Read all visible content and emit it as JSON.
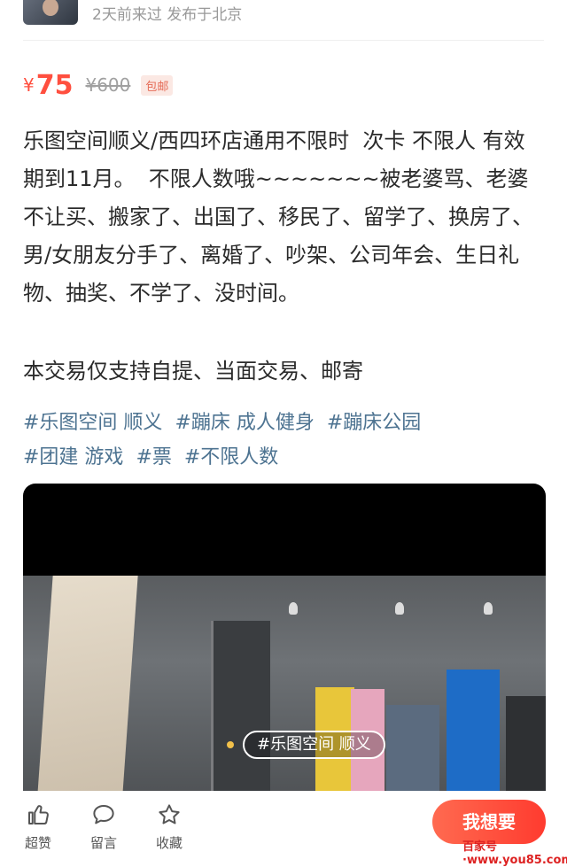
{
  "seller": {
    "meta": "2天前来过  发布于北京"
  },
  "price": {
    "currency": "¥",
    "current": "75",
    "original": "¥600",
    "shipping_tag": "包邮"
  },
  "description": "乐图空间顺义/西四环店通用不限时  次卡 不限人 有效期到11月。  不限人数哦~~~~~~~被老婆骂、老婆不让买、搬家了、出国了、移民了、留学了、换房了、男/女朋友分手了、离婚了、吵架、公司年会、生日礼物、抽奖、不学了、没时间。",
  "trade_note": "本交易仅支持自提、当面交易、邮寄",
  "tags": [
    "#乐图空间 顺义",
    "#蹦床 成人健身",
    "#蹦床公园",
    "#团建 游戏",
    "#票",
    "#不限人数"
  ],
  "media": {
    "caption": "#乐图空间 顺义"
  },
  "actions": {
    "like": "超赞",
    "comment": "留言",
    "favorite": "收藏",
    "want": "我想要"
  },
  "watermark": "百家号·www.you85.com",
  "colors": {
    "accent": "#ff4f3f",
    "tag_text": "#4d7391"
  }
}
